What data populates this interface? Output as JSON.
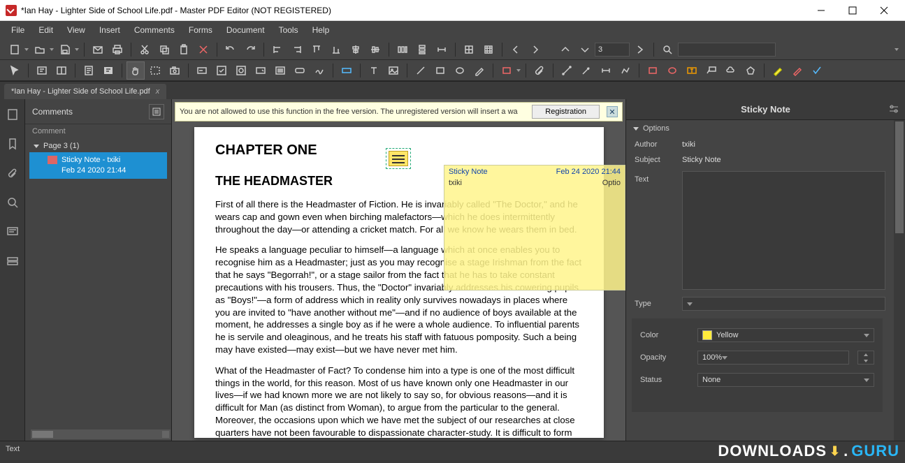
{
  "window": {
    "title": "*Ian Hay - Lighter Side of School Life.pdf - Master PDF Editor (NOT REGISTERED)"
  },
  "menu": [
    "File",
    "Edit",
    "View",
    "Insert",
    "Comments",
    "Forms",
    "Document",
    "Tools",
    "Help"
  ],
  "nav": {
    "page_input": "3"
  },
  "tab": {
    "label": "*Ian Hay - Lighter Side of School Life.pdf"
  },
  "comments": {
    "title": "Comments",
    "column": "Comment",
    "page_node": "Page 3 (1)",
    "note_line1": "Sticky Note - txiki",
    "note_line2": "Feb 24 2020 21:44"
  },
  "banner": {
    "text": "You are not allowed to use this function in the free version.   The unregistered version will insert a wa",
    "button": "Registration"
  },
  "document": {
    "chapter": "CHAPTER ONE",
    "heading": "THE HEADMASTER",
    "p1": "First of all there is the Headmaster of Fiction. He is invariably called \"The Doctor,\" and he wears cap and gown even when birching malefactors—which he does intermittently throughout the day—or attending a cricket match. For all we know he wears them in bed.",
    "p2": "He speaks a language peculiar to himself—a language which at once enables you to recognise him as a Headmaster; just as you may recognise a stage Irishman from the fact that he says \"Begorrah!\", or a stage sailor from the fact that he has to take constant precautions with his trousers. Thus, the \"Doctor\" invariably addresses his cowering pupils as \"Boys!\"—a form of address which in reality only survives nowadays in places where you are invited to \"have another without me\"—and if no audience of boys available at the moment, he addresses a single boy as if he were a whole audience. To influential parents he is servile and oleaginous, and he treats his staff with fatuous pomposity. Such a being may have existed—may exist—but we have never met him.",
    "p3": "What of the Headmaster of Fact? To condense him into a type is one of the most difficult things in the world, for this reason. Most of us have known only one Headmaster in our lives—if we had known more we are not likely to say so, for obvious reasons—and it is difficult for Man (as distinct from Woman), to argue from the particular to the general. Moreover, the occasions upon which we have met the subject of our researches at close quarters have not been favourable to dispassionate character-study. It is difficult to form"
  },
  "popup": {
    "title": "Sticky Note",
    "date": "Feb 24 2020 21:44",
    "author": "txiki",
    "options": "Optio"
  },
  "panel": {
    "title": "Sticky Note",
    "section": "Options",
    "author_label": "Author",
    "author_value": "txiki",
    "subject_label": "Subject",
    "subject_value": "Sticky Note",
    "text_label": "Text",
    "type_label": "Type",
    "color_label": "Color",
    "color_value": "Yellow",
    "opacity_label": "Opacity",
    "opacity_value": "100%",
    "status_label": "Status",
    "status_value": "None"
  },
  "status": {
    "text": "Text"
  },
  "watermark": {
    "a": "DOWNLOADS",
    "b": "GURU"
  }
}
